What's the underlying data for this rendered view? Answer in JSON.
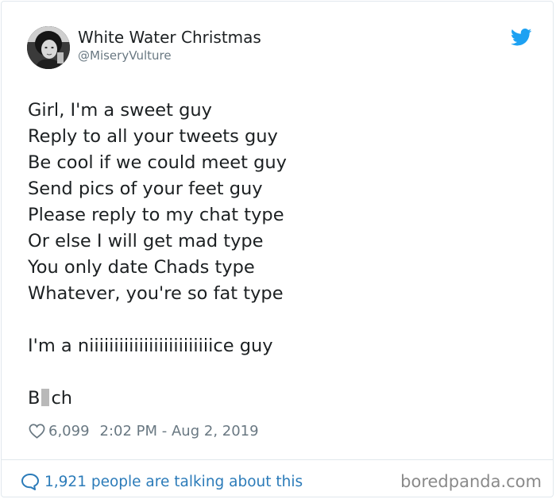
{
  "author": {
    "display_name": "White Water Christmas",
    "handle": "@MiseryVulture"
  },
  "tweet": {
    "stanza1": [
      "Girl, I'm a sweet guy",
      "Reply to all your tweets guy",
      "Be cool if we could meet guy",
      "Send pics of your feet guy",
      "Please reply to my chat type",
      "Or else I will get mad type",
      "You only date Chads type",
      "Whatever, you're so fat type"
    ],
    "line_nice": "I'm a niiiiiiiiiiiiiiiiiiiiiiiiice guy",
    "sign_off_start": "B",
    "sign_off_end": "ch"
  },
  "meta": {
    "likes": "6,099",
    "timestamp": "2:02 PM - Aug 2, 2019"
  },
  "footer": {
    "conversation_text": "1,921 people are talking about this",
    "watermark": "boredpanda.com"
  },
  "icons": {
    "twitter_bird": "twitter-bird-icon",
    "heart": "heart-icon",
    "comment": "comment-bubble-icon"
  },
  "colors": {
    "twitter_blue": "#1da1f2",
    "link_blue": "#2b7bb9",
    "text": "#1c2022",
    "muted": "#697882"
  }
}
